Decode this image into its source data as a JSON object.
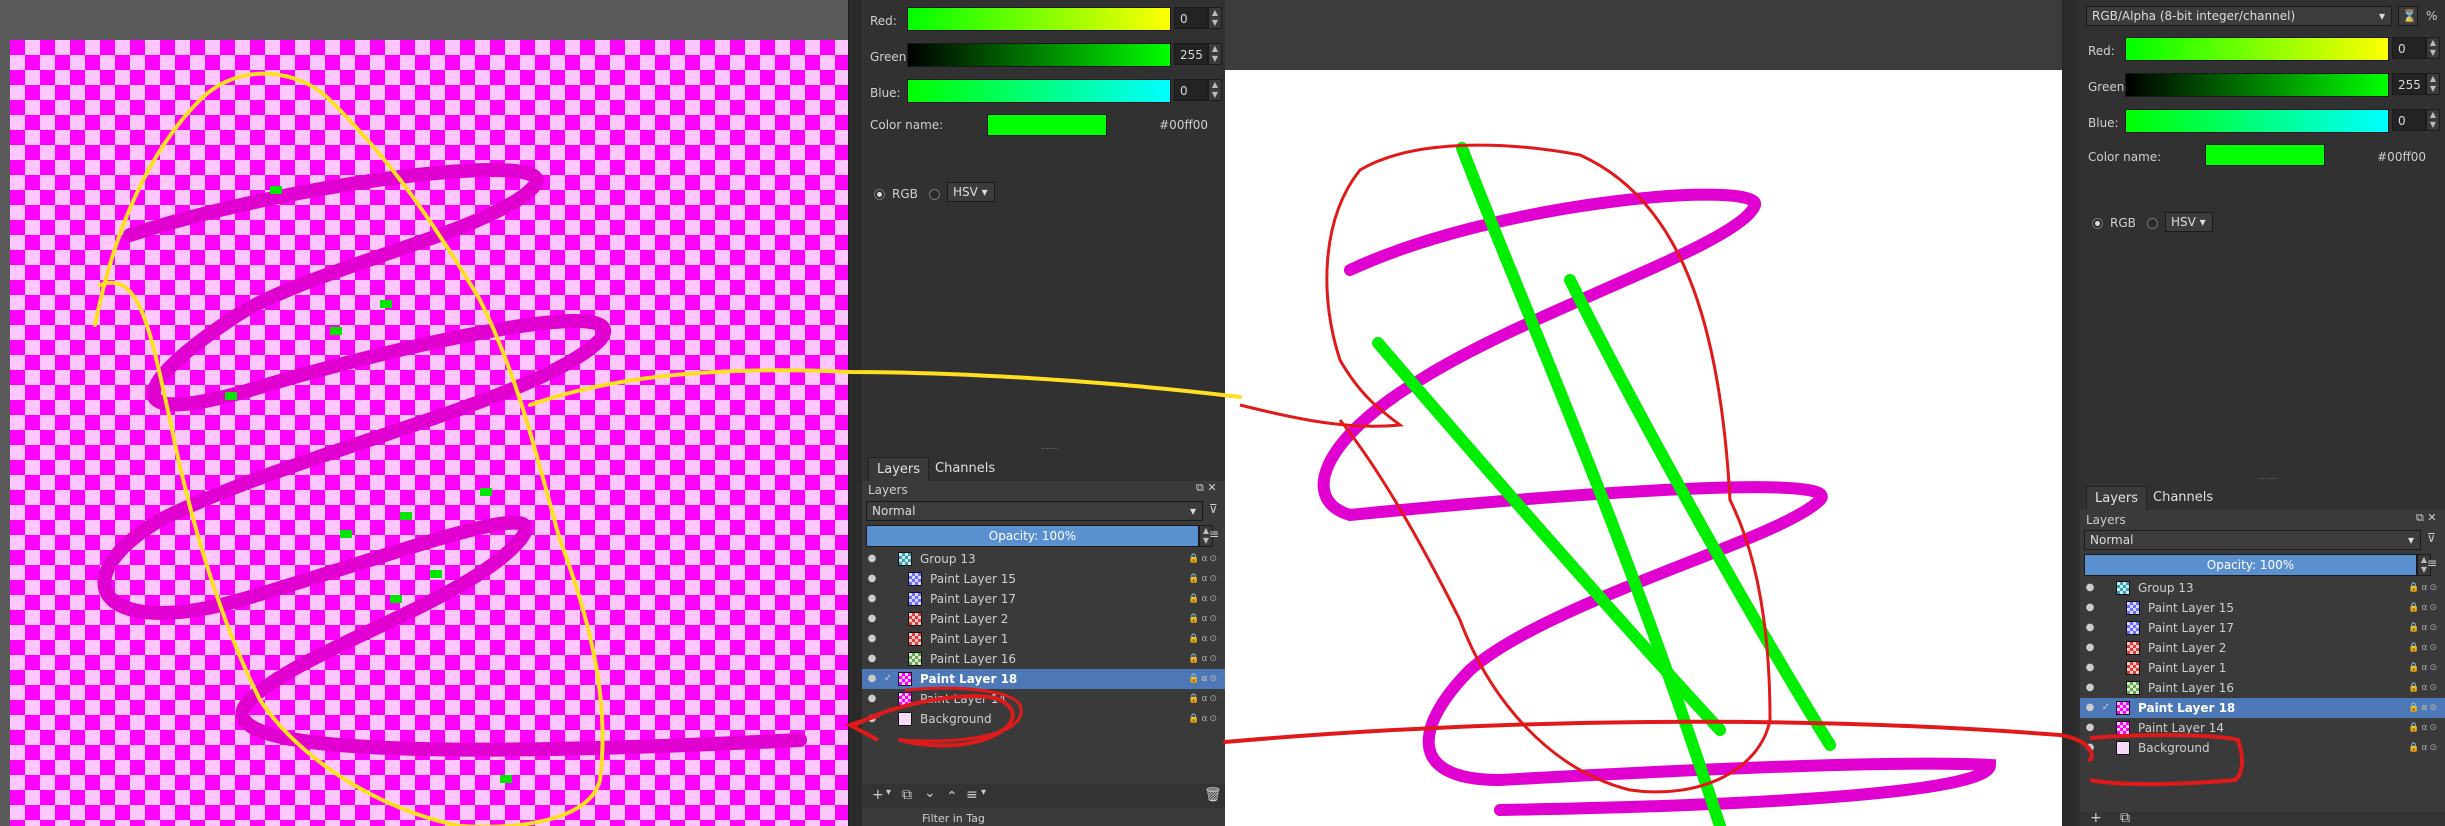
{
  "colors": {
    "magenta": "#ff00ff",
    "pink": "#ffc7ff",
    "green": "#00ff00",
    "yellow": "#ffe020",
    "red": "#e01a1a",
    "selection": "#4d78b8",
    "opacity_bar": "#5a8fd0"
  },
  "left_docker": {
    "channels": [
      {
        "label": "Red:",
        "value": "0"
      },
      {
        "label": "Green:",
        "value": "255"
      },
      {
        "label": "Blue:",
        "value": "0"
      }
    ],
    "color_name_label": "Color name:",
    "color_name_value": "#00ff00",
    "model_rgb": "RGB",
    "model_hsv": "HSV",
    "tabs": [
      "Layers",
      "Channels"
    ],
    "panel_title": "Layers",
    "blend_mode": "Normal",
    "opacity": "Opacity: 100%",
    "layers": [
      {
        "name": "Group 13",
        "thumb": "th-teal",
        "selected": false
      },
      {
        "name": "Paint Layer 15",
        "thumb": "th-blue",
        "selected": false
      },
      {
        "name": "Paint Layer 17",
        "thumb": "th-blue",
        "selected": false
      },
      {
        "name": "Paint Layer 2",
        "thumb": "th-red",
        "selected": false
      },
      {
        "name": "Paint Layer 1",
        "thumb": "th-red",
        "selected": false
      },
      {
        "name": "Paint Layer 16",
        "thumb": "th-green",
        "selected": false
      },
      {
        "name": "Paint Layer 18",
        "thumb": "th-magenta",
        "selected": true
      },
      {
        "name": "Paint Layer 14",
        "thumb": "th-magenta",
        "selected": false
      },
      {
        "name": "Background",
        "thumb": "th-white",
        "selected": false
      }
    ],
    "bottom_toolbar": [
      "+",
      "▾",
      "⧉",
      "⌄",
      "⌃",
      "≡",
      "▾",
      "🗑"
    ],
    "filter_label": "Filter in Tag"
  },
  "right_docker": {
    "color_space": "RGB/Alpha (8-bit integer/channel)",
    "percent": "%",
    "channels": [
      {
        "label": "Red:",
        "value": "0"
      },
      {
        "label": "Green:",
        "value": "255"
      },
      {
        "label": "Blue:",
        "value": "0"
      }
    ],
    "color_name_label": "Color name:",
    "color_name_value": "#00ff00",
    "model_rgb": "RGB",
    "model_hsv": "HSV",
    "tabs": [
      "Layers",
      "Channels"
    ],
    "panel_title": "Layers",
    "blend_mode": "Normal",
    "opacity": "Opacity: 100%",
    "layers": [
      {
        "name": "Group 13",
        "thumb": "th-teal",
        "selected": false
      },
      {
        "name": "Paint Layer 15",
        "thumb": "th-blue",
        "selected": false
      },
      {
        "name": "Paint Layer 17",
        "thumb": "th-blue",
        "selected": false
      },
      {
        "name": "Paint Layer 2",
        "thumb": "th-red",
        "selected": false
      },
      {
        "name": "Paint Layer 1",
        "thumb": "th-red",
        "selected": false
      },
      {
        "name": "Paint Layer 16",
        "thumb": "th-green",
        "selected": false
      },
      {
        "name": "Paint Layer 18",
        "thumb": "th-magenta",
        "selected": true
      },
      {
        "name": "Paint Layer 14",
        "thumb": "th-magenta",
        "selected": false
      },
      {
        "name": "Background",
        "thumb": "th-white",
        "selected": false
      }
    ]
  }
}
